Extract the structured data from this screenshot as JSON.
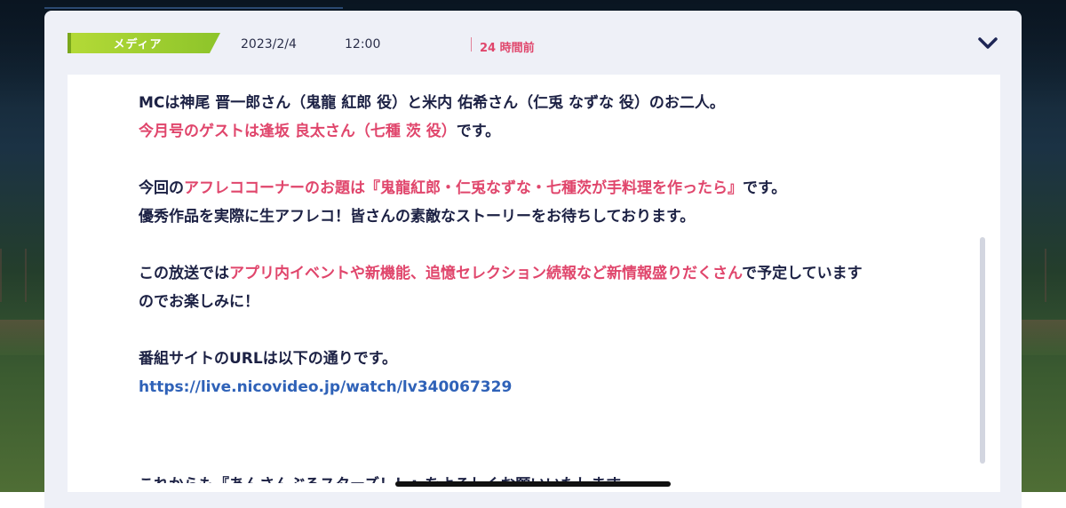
{
  "article": {
    "category": "メディア",
    "date": "2023/2/4",
    "time": "12:00",
    "elapsed": "24 時間前",
    "collapse_icon": "chevron-down-icon"
  },
  "body": {
    "line1": "MCは神尾 晋一郎さん（鬼龍 紅郎 役）と米内 佑希さん（仁兎 なずな 役）のお二人。",
    "line2_hl": "今月号のゲストは逢坂 良太さん（七種 茨 役）",
    "line2_rest": "です。",
    "line3_a": "今回の",
    "line3_hl": "アフレココーナーのお題は『鬼龍紅郎・仁兎なずな・七種茨が手料理を作ったら』",
    "line3_b": "です。",
    "line4": "優秀作品を実際に生アフレコ！皆さんの素敵なストーリーをお待ちしております。",
    "line5_a": "この放送では",
    "line5_hl": "アプリ内イベントや新機能、追憶セレクション続報など新情報盛りだくさん",
    "line5_b": "で予定しています",
    "line6": "のでお楽しみに！",
    "line7": "番組サイトのURLは以下の通りです。",
    "link": "https://live.nicovideo.jp/watch/lv340067329",
    "cut_line": "これからも『あんさんぶるスターズ！！』をよろしくお願いいたします。"
  },
  "colors": {
    "accent_pink": "#e0466c",
    "tag_green": "#b4da37",
    "link_blue": "#2f62b8",
    "text_navy": "#1c2144"
  }
}
